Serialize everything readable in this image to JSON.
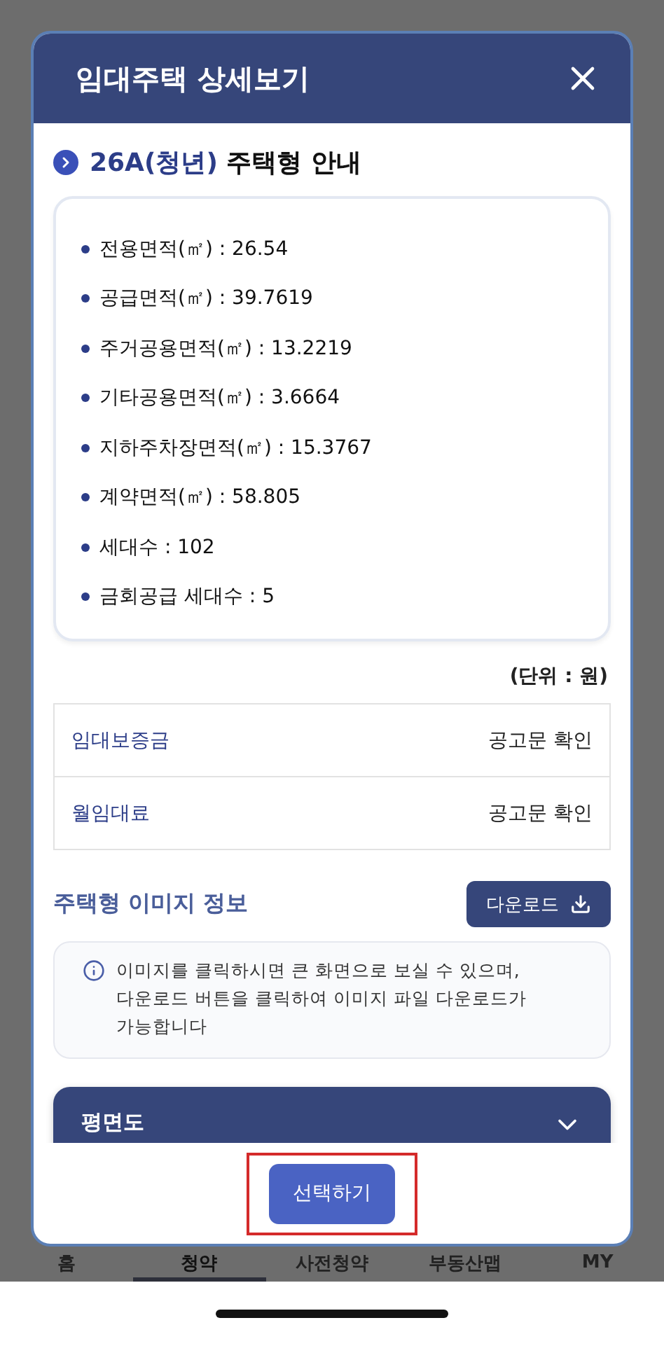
{
  "modal": {
    "title": "임대주택 상세보기"
  },
  "section": {
    "title_highlight": "26A(청년)",
    "title_rest": "주택형 안내"
  },
  "specs": [
    "전용면적(㎡) : 26.54",
    "공급면적(㎡) : 39.7619",
    "주거공용면적(㎡) : 13.2219",
    "기타공용면적(㎡) : 3.6664",
    "지하주차장면적(㎡) : 15.3767",
    "계약면적(㎡) : 58.805",
    "세대수 : 102",
    "금회공급 세대수 : 5"
  ],
  "unit_note": "(단위 : 원)",
  "rent_table": [
    {
      "label": "임대보증금",
      "value": "공고문 확인"
    },
    {
      "label": "월임대료",
      "value": "공고문 확인"
    }
  ],
  "image_info": {
    "title": "주택형 이미지 정보",
    "download_button": "다운로드",
    "notice": "이미지를 클릭하시면 큰 화면으로 보실 수 있으며,\n다운로드 버튼을 클릭하여 이미지 파일 다운로드가\n가능합니다"
  },
  "accordion": {
    "title": "평면도",
    "expanded": false
  },
  "footer": {
    "button": "선택하기",
    "highlighted": true
  },
  "tab_bar": [
    {
      "label": "홈",
      "selected": false
    },
    {
      "label": "청약",
      "selected": true
    },
    {
      "label": "사전청약",
      "selected": false
    },
    {
      "label": "부동산맵",
      "selected": false
    },
    {
      "label": "MY",
      "selected": false
    }
  ]
}
